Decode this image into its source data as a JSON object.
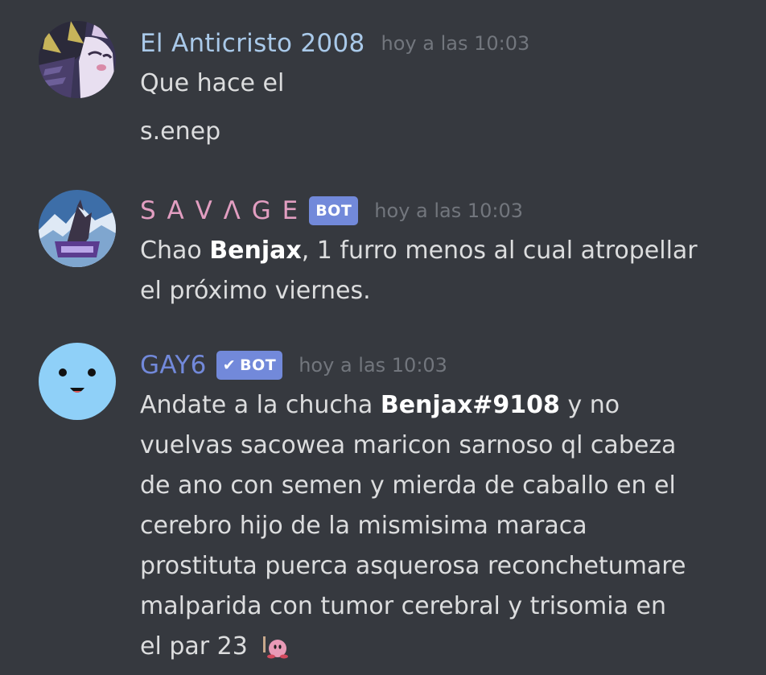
{
  "messages": [
    {
      "username": "El Anticristo 2008",
      "username_color": "#a9c9e9",
      "timestamp": "hoy a las 10:03",
      "lines": [
        "Que hace el",
        "s.enep"
      ]
    },
    {
      "username": "S A V Λ G E",
      "username_color": "#e29ec1",
      "bot_tag": "BOT",
      "timestamp": "hoy a las 10:03",
      "line1": {
        "pre": "Chao ",
        "bold": "Benjax",
        "post": ", 1 furro menos al cual atropellar"
      },
      "line2": "el próximo viernes."
    },
    {
      "username": "GAY6",
      "username_color": "#7289da",
      "bot_tag": "BOT",
      "bot_verified_icon": "checkmark-icon",
      "timestamp": "hoy a las 10:03",
      "line1": {
        "pre": "Andate a la chucha ",
        "bold": "Benjax#9108",
        "post": " y no"
      },
      "lines": [
        "vuelvas sacowea maricon sarnoso ql cabeza",
        "de ano con semen y mierda de caballo en el",
        "cerebro hijo de la mismisima maraca",
        "prostituta puerca asquerosa reconchetumare",
        "malparida con tumor cerebral y trisomia en",
        "el par 23"
      ],
      "emoji": "kirby-emoji-icon"
    }
  ]
}
